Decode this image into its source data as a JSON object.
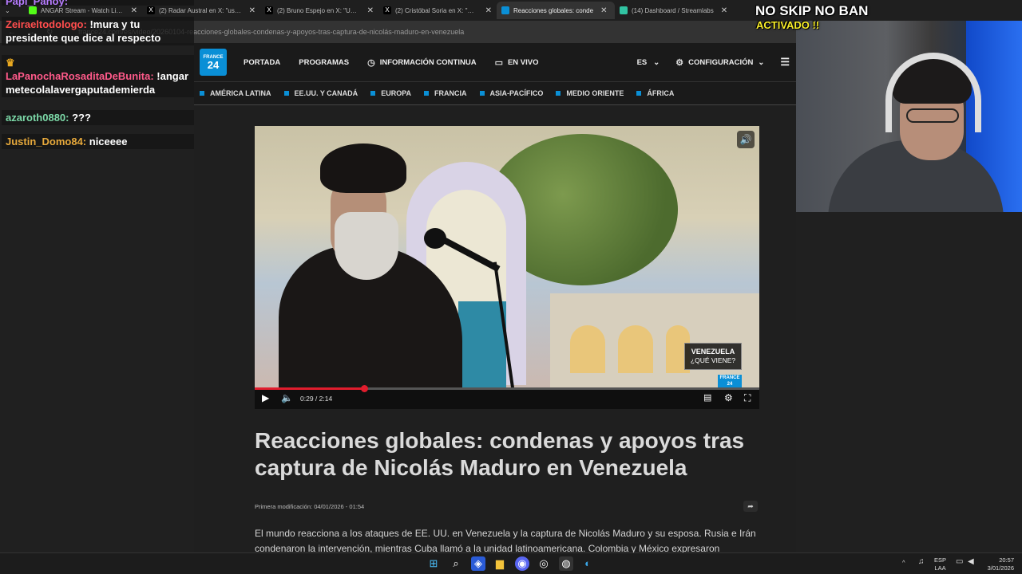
{
  "browser": {
    "tabs": [
      {
        "title": "ANGAR Stream - Watch Live on",
        "icon": "kick-icon",
        "color": "#53fc18"
      },
      {
        "title": "(2) Radar Austral en X: \"usv£ Al",
        "icon": "x-icon",
        "color": "#000000"
      },
      {
        "title": "(2) Bruno Espejo en X: \"Usemo",
        "icon": "x-icon",
        "color": "#000000"
      },
      {
        "title": "(2) Cristóbal Soria en X: \"Mand",
        "icon": "x-icon",
        "color": "#000000"
      },
      {
        "title": "Reacciones globales: conde",
        "icon": "france24-icon",
        "color": "#0a8fd6"
      },
      {
        "title": "(14) Dashboard / Streamlabs",
        "icon": "streamlabs-icon",
        "color": "#31c3a2"
      }
    ],
    "url": "france24.com/es/video/20260104-reacciones-globales-condenas-y-apoyos-tras-captura-de-nicolás-maduro-en-venezuela"
  },
  "site": {
    "logo": {
      "line1": "FRANCE",
      "line2": "24"
    },
    "nav": [
      {
        "label": "PORTADA",
        "icon": ""
      },
      {
        "label": "PROGRAMAS",
        "icon": ""
      },
      {
        "label": "INFORMACIÓN CONTINUA",
        "icon": "clock-icon"
      },
      {
        "label": "EN VIVO",
        "icon": "tv-icon"
      }
    ],
    "language": "ES",
    "settings": "CONFIGURACIÓN",
    "regions": [
      "AMÉRICA LATINA",
      "EE.UU. Y CANADÁ",
      "EUROPA",
      "FRANCIA",
      "ASIA-PACÍFICO",
      "MEDIO ORIENTE",
      "ÁFRICA"
    ],
    "accent_color": "#0a8fd6"
  },
  "video": {
    "badge_title": "VENEZUELA",
    "badge_subtitle": "¿QUÉ VIENE?",
    "logo_text": "FRANCE 24",
    "time": "0:29 / 2:14",
    "progress": 0.216,
    "progress_color": "#e11d2d"
  },
  "article": {
    "title": "Reacciones globales: condenas y apoyos tras captura de Nicolás Maduro en Venezuela",
    "modified": "Primera modificación: 04/01/2026 - 01:54",
    "body": "El mundo reacciona a los ataques de EE. UU. en Venezuela y la captura de Nicolás Maduro y su esposa. Rusia e Irán condenaron la intervención, mientras Cuba llamó a la unidad latinoamericana. Colombia y México expresaron"
  },
  "chat": {
    "messages": [
      {
        "user": "Papi_Panoy:",
        "text": "",
        "color": "#b77cff"
      },
      {
        "user": "Zeiraeltodologo:",
        "text": " !mura y tu presidente que dice al respecto",
        "color": "#ff4d4d"
      },
      {
        "user": "LaPanochaRosaditaDeBunita:",
        "text": " !angar metecolalavergaputademierda",
        "color": "#ff5a8a"
      },
      {
        "user": "azaroth0880:",
        "text": " ???",
        "color": "#7cd9a8"
      },
      {
        "user": "Justin_Domo84:",
        "text": " niceeee",
        "color": "#e7a93b"
      }
    ]
  },
  "overlay": {
    "banner_line1": "NO SKIP NO BAN",
    "banner_line2": "ACTIVADO !!"
  },
  "taskbar": {
    "language_top": "ESP",
    "language_bottom": "LAA",
    "time": "20:57",
    "date": "3/01/2026"
  }
}
